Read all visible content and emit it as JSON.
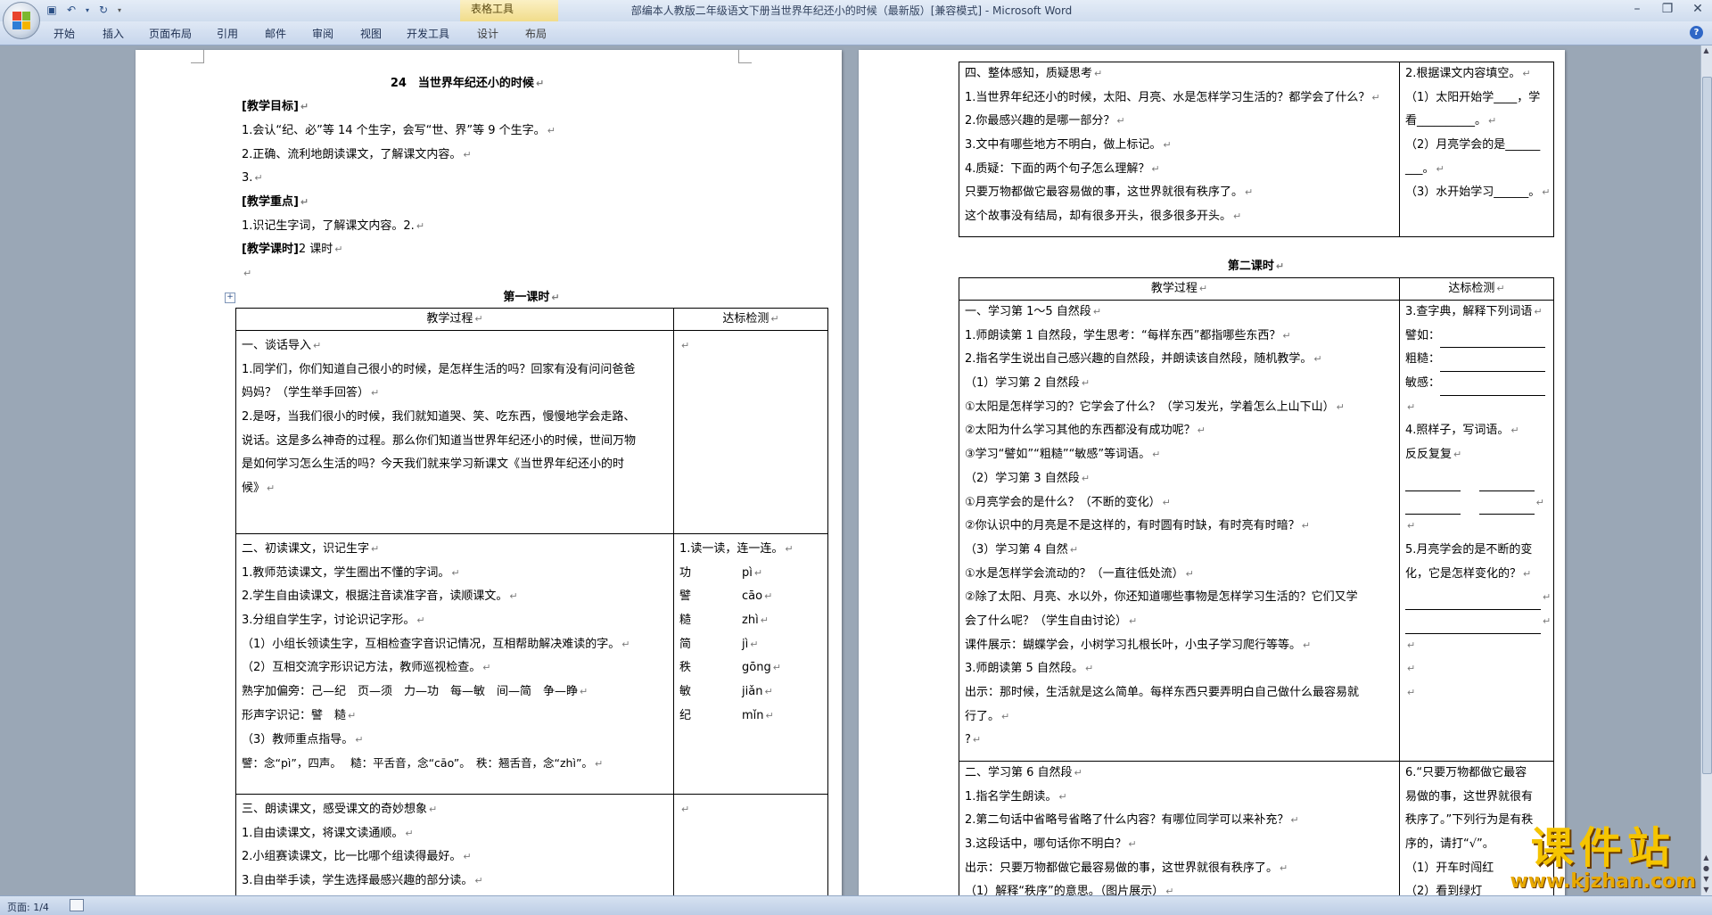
{
  "app": {
    "document_title": "部编本人教版二年级语文下册当世界年纪还小的时候（最新版）[兼容模式] - Microsoft Word",
    "context_tool_title": "表格工具",
    "tabs": [
      "开始",
      "插入",
      "页面布局",
      "引用",
      "邮件",
      "审阅",
      "视图",
      "开发工具",
      "设计",
      "布局"
    ]
  },
  "statusbar": {
    "page": "页面: 1/4"
  },
  "watermark": {
    "name": "课件站",
    "url": "www.kjzhan.com"
  },
  "left_page": {
    "title": "24　当世界年纪还小的时候",
    "goal_header": "[教学目标]",
    "goals": [
      "1.会认“纪、必”等 14 个生字，会写“世、界”等 9 个生字。",
      "2.正确、流利地朗读课文，了解课文内容。",
      "3."
    ],
    "key_header": "[教学重点]",
    "key_text": "1.识记生字词，了解课文内容。2.",
    "period_label": "[教学课时]",
    "period_value": "2 课时",
    "lesson1_title": "第一课时",
    "table_head": [
      "教学过程",
      "达标检测"
    ],
    "sec1": [
      "一、谈话导入",
      "1.同学们，你们知道自己很小的时候，是怎样生活的吗？回家有没有问问爸爸",
      "妈妈？（学生举手回答）",
      "2.是呀，当我们很小的时候，我们就知道哭、笑、吃东西，慢慢地学会走路、",
      "说话。这是多么神奇的过程。那么你们知道当世界年纪还小的时候，世间万物",
      "是如何学习怎么生活的吗？今天我们就来学习新课文《当世界年纪还小的时",
      "候》"
    ],
    "sec2": [
      "二、初读课文，识记生字",
      "1.教师范读课文，学生圈出不懂的字词。",
      "2.学生自由读课文，根据注音读准字音，读顺课文。",
      "3.分组自学生字，讨论识记字形。",
      "（1）小组长领读生字，互相检查字音识记情况，互相帮助解决难读的字。",
      "（2）互相交流字形识记方法，教师巡视检查。",
      "熟字加偏旁：己—纪　页—须　力—功　每—敏　间—简　争—睁",
      "形声字识记：譬　糙",
      "（3）教师重点指导。",
      "譬：念“pì”，四声。　 糙：平舌音，念“cāo”。　秩：翘舌音，念“zhì”。"
    ],
    "sec2_check": {
      "title": "1.读一读，连一连。",
      "pairs": [
        [
          "功",
          "pì"
        ],
        [
          "譬",
          "cāo"
        ],
        [
          "糙",
          "zhì"
        ],
        [
          "简",
          "jì"
        ],
        [
          "秩",
          "gōng"
        ],
        [
          "敏",
          "jiǎn"
        ],
        [
          "纪",
          "mǐn"
        ]
      ]
    },
    "sec3": [
      "三、朗读课文，感受课文的奇妙想象",
      "1.自由读课文，将课文读通顺。",
      "2.小组赛读课文，比一比哪个组读得最好。",
      "3.自由举手读，学生选择最感兴趣的部分读。"
    ]
  },
  "right_page": {
    "sec4": [
      "四、整体感知，质疑思考",
      "1.当世界年纪还小的时候，太阳、月亮、水是怎样学习生活的？都学会了什么？",
      "2.你最感兴趣的是哪一部分？",
      "3.文中有哪些地方不明白，做上标记。",
      "4.质疑：下面的两个句子怎么理解？",
      "只要万物都做它最容易做的事，这世界就很有秩序了。",
      "这个故事没有结局，却有很多开头，很多很多开头。"
    ],
    "sec4_check": [
      "2.根据课文内容填空。",
      "（1）太阳开始学____，学",
      "看__________。",
      "（2）月亮学会的是______",
      "___。",
      "（3）水开始学习______。"
    ],
    "lesson2_title": "第二课时",
    "table_head": [
      "教学过程",
      "达标检测"
    ],
    "secA": [
      "一、学习第 1～5 自然段",
      "1.师朗读第 1 自然段，学生思考：“每样东西”都指哪些东西？",
      "2.指名学生说出自己感兴趣的自然段，并朗读该自然段，随机教学。",
      "（1）学习第 2 自然段",
      "①太阳是怎样学习的？它学会了什么？（学习发光，学着怎么上山下山）",
      "②太阳为什么学习其他的东西都没有成功呢？",
      "③学习“譬如”“粗糙”“敏感”等词语。",
      "（2）学习第 3 自然段",
      "①月亮学会的是什么？（不断的变化）",
      "②你认识中的月亮是不是这样的，有时圆有时缺，有时亮有时暗？",
      "（3）学习第 4 自然",
      "①水是怎样学会流动的？（一直往低处流）",
      "②除了太阳、月亮、水以外，你还知道哪些事物是怎样学习生活的？它们又学",
      "会了什么呢？（学生自由讨论）",
      "课件展示：蝴蝶学会，小树学习扎根长叶，小虫子学习爬行等等。",
      "3.师朗读第 5 自然段。",
      "出示：那时候，生活就是这么简单。每样东西只要弄明白自己做什么最容易就",
      "行了。",
      "?"
    ],
    "secA_check": {
      "q3": "3.查字典，解释下列词语",
      "words": [
        "譬如：",
        "粗糙：",
        "敏感："
      ],
      "q4": "4.照样子，写词语。",
      "sample": "反反复复",
      "q5a": "5.月亮学会的是不断的变",
      "q5b": "化，它是怎样变化的？"
    },
    "secB": [
      "二、学习第 6 自然段",
      "1.指名学生朗读。",
      "2.第二句话中省略号省略了什么内容？有哪位同学可以来补充？",
      "3.这段话中，哪句话你不明白？",
      "出示：只要万物都做它最容易做的事，这世界就很有秩序了。",
      "（1）解释“秩序”的意思。（图片展示）"
    ],
    "secB_check": [
      "6.“只要万物都做它最容",
      "易做的事，这世界就很有",
      "秩序了。”下列行为是有秩",
      "序的，请打“√”。",
      "（1）开车时闯红",
      "（2）看到绿灯"
    ]
  }
}
